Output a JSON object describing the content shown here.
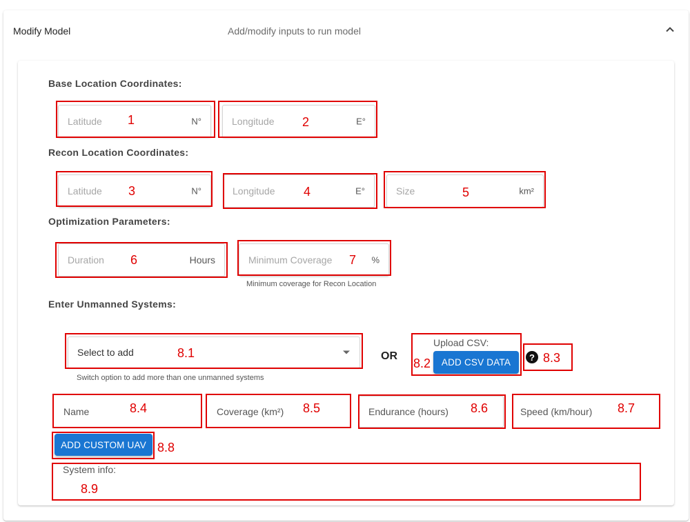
{
  "accordion": {
    "title": "Modify Model",
    "subtitle": "Add/modify inputs to run model"
  },
  "base": {
    "heading": "Base Location Coordinates:",
    "latitude": {
      "placeholder": "Latitude",
      "unit": "N°",
      "marker": "1"
    },
    "longitude": {
      "placeholder": "Longitude",
      "unit": "E°",
      "marker": "2"
    }
  },
  "recon": {
    "heading": "Recon Location Coordinates:",
    "latitude": {
      "placeholder": "Latitude",
      "unit": "N°",
      "marker": "3"
    },
    "longitude": {
      "placeholder": "Longitude",
      "unit": "E°",
      "marker": "4"
    },
    "size": {
      "placeholder": "Size",
      "unit": "km²",
      "marker": "5"
    }
  },
  "optimization": {
    "heading": "Optimization Parameters:",
    "duration": {
      "placeholder": "Duration",
      "unit": "Hours",
      "marker": "6"
    },
    "coverage": {
      "placeholder": "Minimum Coverage",
      "unit": "%",
      "marker": "7",
      "helper": "Minimum coverage for Recon Location"
    }
  },
  "unmanned": {
    "heading": "Enter Unmanned Systems:",
    "select": {
      "value": "Select to add",
      "marker": "8.1",
      "helper": "Switch option to add more than one unmanned systems"
    },
    "or_label": "OR",
    "upload": {
      "label": "Upload CSV:",
      "button": "ADD CSV DATA",
      "marker": "8.2"
    },
    "help": {
      "icon": "help-circle-icon",
      "marker": "8.3"
    },
    "name": {
      "placeholder": "Name",
      "marker": "8.4"
    },
    "coverage": {
      "placeholder": "Coverage (km²)",
      "marker": "8.5"
    },
    "endurance": {
      "placeholder": "Endurance (hours)",
      "marker": "8.6"
    },
    "speed": {
      "placeholder": "Speed (km/hour)",
      "marker": "8.7"
    },
    "add_custom": {
      "button": "ADD CUSTOM UAV",
      "marker": "8.8"
    },
    "system_info": {
      "label": "System info:",
      "marker": "8.9"
    }
  },
  "colors": {
    "annotation": "#e00000",
    "button": "#1976d2"
  }
}
